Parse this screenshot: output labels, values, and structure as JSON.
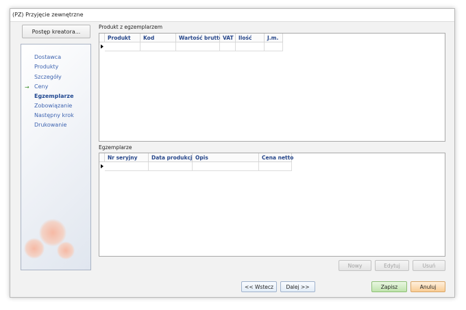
{
  "window": {
    "title": "(PZ) Przyjęcie zewnętrzne"
  },
  "sidebar": {
    "wizard_button": "Postęp kreatora...",
    "active_marker": "→",
    "steps": [
      {
        "label": "Dostawca",
        "active": false
      },
      {
        "label": "Produkty",
        "active": false
      },
      {
        "label": "Szczegóły",
        "active": false
      },
      {
        "label": "Ceny",
        "active": false
      },
      {
        "label": "Egzemplarze",
        "active": true
      },
      {
        "label": "Zobowiązanie",
        "active": false
      },
      {
        "label": "Następny krok",
        "active": false
      },
      {
        "label": "Drukowanie",
        "active": false
      }
    ]
  },
  "products_section": {
    "label": "Produkt z egzemplarzem",
    "columns": [
      "Produkt",
      "Kod",
      "Wartość brutto",
      "VAT",
      "Ilość",
      "J.m."
    ]
  },
  "instances_section": {
    "label": "Egzemplarze",
    "columns": [
      "Nr seryjny",
      "Data produkcji",
      "Opis",
      "Cena netto"
    ]
  },
  "actions": {
    "new": "Nowy",
    "edit": "Edytuj",
    "delete": "Usuń"
  },
  "navigation": {
    "back": "<< Wstecz",
    "next": "Dalej >>"
  },
  "footer": {
    "save": "Zapisz",
    "cancel": "Anuluj"
  }
}
